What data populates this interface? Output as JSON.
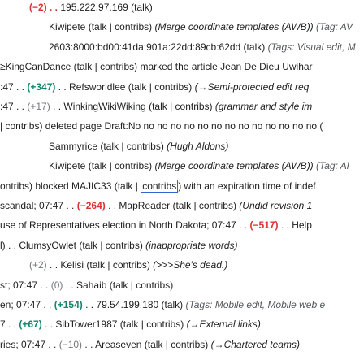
{
  "lines": [
    {
      "x": 36,
      "parts": [
        [
          "(−2) . . ",
          "neg"
        ],
        [
          "195.222.97.169 (talk)",
          "link"
        ]
      ]
    },
    {
      "x": 60,
      "parts": [
        [
          "Kiwipete (talk | contribs) ",
          "link"
        ],
        [
          "(Merge coordinate templates (AWB)) ",
          "it"
        ],
        [
          "(Tag: AV",
          "tags"
        ]
      ]
    },
    {
      "x": 60,
      "parts": [
        [
          "2603:8000:bd00:41da:901a:22dd:89cb:62dd (talk) ",
          "link"
        ],
        [
          "(Tags: Visual edit, M",
          "tags"
        ]
      ]
    },
    {
      "x": 0,
      "parts": [
        [
          "≥KingCanDance (talk | contribs) marked the article Jean De Dieu Uwihar",
          "link"
        ]
      ]
    },
    {
      "x": 0,
      "parts": [
        [
          ":47 . . ",
          "link"
        ],
        [
          "(+347)",
          "pos"
        ],
        [
          " . . Refsworldlee (talk | contribs) ",
          "link"
        ],
        [
          "(→Semi-protected edit req",
          "it"
        ]
      ]
    },
    {
      "x": 0,
      "parts": [
        [
          ":47 . . ",
          "link"
        ],
        [
          "(+17)",
          "neutral"
        ],
        [
          " . . WinkingWikiWiking (talk | contribs) ",
          "link"
        ],
        [
          "(grammar and style im",
          "it"
        ]
      ]
    },
    {
      "x": 0,
      "parts": [
        [
          "| contribs) deleted page Draft:No no no no no no no no no no no no no no (",
          "link"
        ]
      ]
    },
    {
      "x": 60,
      "parts": [
        [
          "Sammyrice (talk | contribs) ",
          "link"
        ],
        [
          "(Hugh Aldons)",
          "it"
        ]
      ]
    },
    {
      "x": 60,
      "parts": [
        [
          "Kiwipete (talk | contribs) ",
          "link"
        ],
        [
          "(Merge coordinate templates (AWB)) ",
          "it"
        ],
        [
          "(Tag: Al",
          "tags"
        ]
      ]
    },
    {
      "x": 0,
      "parts": [
        [
          "ontribs) blocked MAJIC33 (talk | ",
          "link"
        ],
        [
          "contribs",
          "boxed"
        ],
        [
          ") with an expiration time of indef",
          "link"
        ]
      ]
    },
    {
      "x": 0,
      "parts": [
        [
          "scandal; 07:47 . . ",
          "link"
        ],
        [
          "(−264)",
          "neg"
        ],
        [
          " . . MapReader (talk | contribs) ",
          "link"
        ],
        [
          "(Undid revision 1",
          "it"
        ]
      ]
    },
    {
      "x": 0,
      "parts": [
        [
          "use of Representatives election in North Dakota; 07:47 . . ",
          "link"
        ],
        [
          "(−517)",
          "neg"
        ],
        [
          " . . Help",
          "link"
        ]
      ]
    },
    {
      "x": 0,
      "parts": [
        [
          "l) . . ClumsyOwlet (talk | contribs) ",
          "link"
        ],
        [
          "(inappropriate words)",
          "it"
        ]
      ]
    },
    {
      "x": 36,
      "parts": [
        [
          "(+2)",
          "neutral"
        ],
        [
          " . . Kelisi (talk | contribs) ",
          "link"
        ],
        [
          "(>>>She's dead.)",
          "it"
        ]
      ]
    },
    {
      "x": 0,
      "parts": [
        [
          "st; 07:47 . . ",
          "link"
        ],
        [
          "(0)",
          "neutral"
        ],
        [
          " . . Sahaib (talk | contribs)",
          "link"
        ]
      ]
    },
    {
      "x": 0,
      "parts": [
        [
          "en; 07:47 . . ",
          "link"
        ],
        [
          "(+154)",
          "pos"
        ],
        [
          " . . 79.54.199.180 (talk) ",
          "link"
        ],
        [
          "(Tags: Mobile edit, Mobile web e",
          "tags"
        ]
      ]
    },
    {
      "x": 0,
      "parts": [
        [
          "7 . . ",
          "link"
        ],
        [
          "(+67)",
          "pos"
        ],
        [
          " . . SibTower1987 (talk | contribs) ",
          "link"
        ],
        [
          "(→External links)",
          "it"
        ]
      ]
    },
    {
      "x": 0,
      "parts": [
        [
          "ries; 07:47 . . ",
          "link"
        ],
        [
          "(−10)",
          "neutral"
        ],
        [
          " . . Areaseven (talk | contribs) ",
          "link"
        ],
        [
          "(→Chartered teams)",
          "it"
        ]
      ]
    }
  ]
}
